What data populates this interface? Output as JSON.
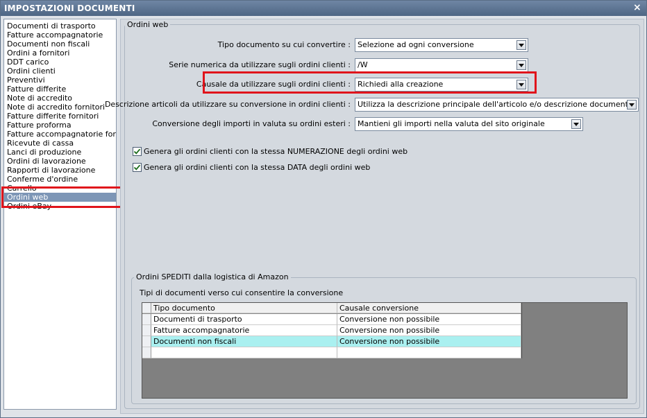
{
  "window": {
    "title": "IMPOSTAZIONI DOCUMENTI",
    "close_label": "×"
  },
  "doc_list": {
    "items": [
      "Documenti di trasporto",
      "Fatture accompagnatorie",
      "Documenti non fiscali",
      "Ordini a fornitori",
      "DDT carico",
      "Ordini clienti",
      "Preventivi",
      "Fatture differite",
      "Note di accredito",
      "Note di accredito fornitori",
      "Fatture differite fornitori",
      "Fatture proforma",
      "Fatture accompagnatorie fornito",
      "Ricevute di cassa",
      "Lanci di produzione",
      "Ordini di lavorazione",
      "Rapporti di lavorazione",
      "Conferme d'ordine",
      "Carrello",
      "Ordini web",
      "Ordini eBay"
    ],
    "selected_index": 19
  },
  "ordini_web": {
    "group_title": "Ordini web",
    "rows": [
      {
        "label": "Tipo documento su cui convertire :",
        "value": "Selezione ad ogni conversione"
      },
      {
        "label": "Serie numerica da utilizzare sugli ordini clienti :",
        "value": "/W"
      },
      {
        "label": "Causale da utilizzare sugli ordini clienti :",
        "value": "Richiedi alla creazione"
      },
      {
        "label": "Descrizione articoli da utilizzare su conversione in ordini clienti :",
        "value": "Utilizza la descrizione principale dell'articolo e/o descrizione documenti"
      },
      {
        "label": "Conversione degli importi in valuta su ordini esteri :",
        "value": "Mantieni gli importi nella valuta del sito originale"
      }
    ],
    "checks": [
      {
        "label": "Genera gli ordini clienti con la stessa NUMERAZIONE degli ordini web",
        "checked": true
      },
      {
        "label": "Genera gli ordini clienti con la stessa DATA degli ordini web",
        "checked": true
      }
    ]
  },
  "amazon": {
    "group_title": "Ordini SPEDITI dalla logistica di Amazon",
    "subtitle": "Tipi di documenti verso cui consentire la conversione",
    "columns": [
      "Tipo documento",
      "Causale conversione"
    ],
    "rows": [
      [
        "Documenti di trasporto",
        "Conversione non possibile"
      ],
      [
        "Fatture accompagnatorie",
        "Conversione non possibile"
      ],
      [
        "Documenti non fiscali",
        "Conversione non possibile"
      ],
      [
        "",
        ""
      ]
    ],
    "selected_row": 2
  },
  "colors": {
    "highlight": "#e0141b",
    "selection": "#7d96b6",
    "row_selected": "#aaf0f0"
  }
}
